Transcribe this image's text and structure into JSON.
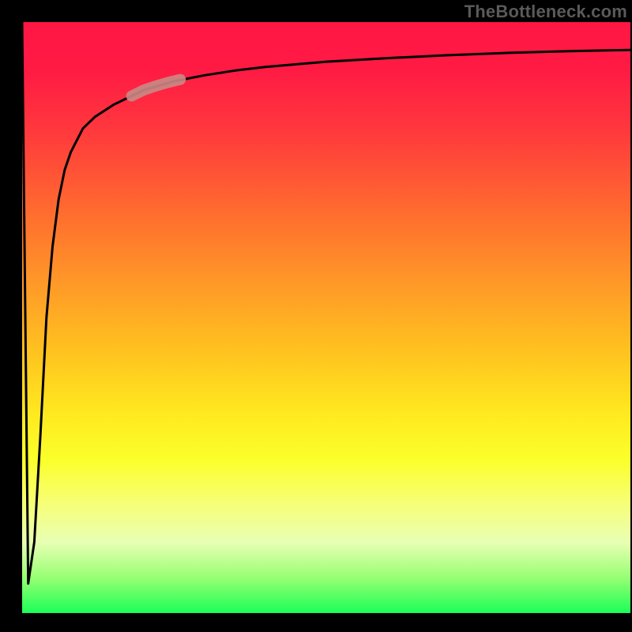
{
  "watermark": "TheBottleneck.com",
  "chart_data": {
    "type": "line",
    "title": "",
    "xlabel": "",
    "ylabel": "",
    "xlim": [
      0,
      100
    ],
    "ylim": [
      0,
      100
    ],
    "grid": false,
    "legend": false,
    "annotations": [],
    "series": [
      {
        "name": "bottleneck-curve",
        "color": "#000000",
        "x": [
          0,
          1,
          2,
          3,
          4,
          5,
          6,
          7,
          8,
          9,
          10,
          12,
          15,
          18,
          20,
          25,
          30,
          35,
          40,
          50,
          60,
          70,
          80,
          90,
          100
        ],
        "values": [
          100,
          5,
          12,
          30,
          50,
          62,
          70,
          75,
          78,
          80,
          82,
          84,
          86,
          87.5,
          88.5,
          90,
          91,
          91.8,
          92.4,
          93.3,
          93.9,
          94.4,
          94.8,
          95.1,
          95.3
        ]
      },
      {
        "name": "highlight-segment",
        "color": "#c98a85",
        "x": [
          18,
          20,
          22,
          24,
          26
        ],
        "values": [
          87.5,
          88.5,
          89.2,
          89.8,
          90.3
        ]
      }
    ]
  }
}
